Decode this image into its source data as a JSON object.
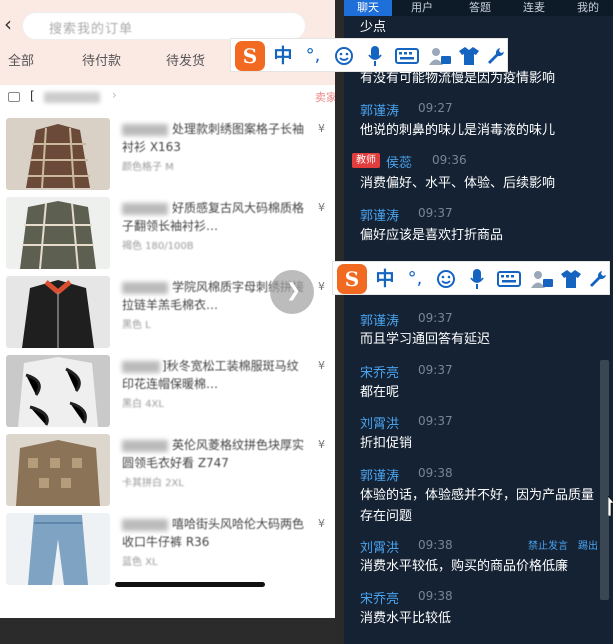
{
  "phone": {
    "search_placeholder": "搜索我的订单",
    "tabs": [
      "全部",
      "待付款",
      "待发货"
    ],
    "shop": {
      "name": "[",
      "status": "卖家"
    },
    "orders": [
      {
        "title": "处理款刺绣图案格子长袖衬衫 X163",
        "spec": "颜色格子 M",
        "price": "¥"
      },
      {
        "title": "好质感复古风大码棉质格子翻领长袖衬衫…",
        "spec": "褐色 180/100B",
        "price": "¥"
      },
      {
        "title": "学院风棉质字母刺绣拼接拉链羊羔毛棉衣…",
        "spec": "黑色 L",
        "price": "¥"
      },
      {
        "title": "]秋冬宽松工装棉服斑马纹印花连帽保暖棉…",
        "spec": "黑白 4XL",
        "price": "¥"
      },
      {
        "title": "英伦风菱格纹拼色块厚实圆领毛衣好看 Z747",
        "spec": "卡其拼白 2XL",
        "price": "¥"
      },
      {
        "title": "嘻哈街头风哈伦大码两色收口牛仔裤 R36",
        "spec": "蓝色 XL",
        "price": "¥"
      }
    ]
  },
  "chat": {
    "tabs": [
      "聊天",
      "用户",
      "答题",
      "连麦",
      "我的"
    ],
    "active_tab": "聊天",
    "messages": [
      {
        "name": "",
        "time": "",
        "text": "少点"
      },
      {
        "name": "",
        "time": "",
        "text": "有没有可能物流慢是因为疫情影响"
      },
      {
        "name": "郭谨涛",
        "time": "09:27",
        "text": "他说的刺鼻的味儿是消毒液的味儿"
      },
      {
        "name": "侯蕊",
        "time": "09:36",
        "text": "消费偏好、水平、体验、后续影响",
        "badge": "教师"
      },
      {
        "name": "郭谨涛",
        "time": "09:37",
        "text": "偏好应该是喜欢打折商品"
      },
      {
        "name": "郭谨涛",
        "time": "09:37",
        "text": "而且学习通回答有延迟"
      },
      {
        "name": "宋乔亮",
        "time": "09:37",
        "text": "都在呢"
      },
      {
        "name": "刘霄洪",
        "time": "09:37",
        "text": "折扣促销"
      },
      {
        "name": "郭谨涛",
        "time": "09:38",
        "text": "体验的话，体验感并不好，因为产品质量存在问题"
      },
      {
        "name": "刘霄洪",
        "time": "09:38",
        "text": "消费水平较低，购买的商品价格低廉",
        "actions": [
          "禁止发言",
          "踢出"
        ]
      },
      {
        "name": "宋乔亮",
        "time": "09:38",
        "text": "消费水平比较低"
      }
    ]
  },
  "ime": {
    "logo": "S",
    "mode": "中",
    "punct": "°,",
    "icons": [
      "emoji-icon",
      "microphone-icon",
      "keyboard-icon",
      "user-card-icon",
      "skin-shirt-icon",
      "wrench-icon"
    ]
  },
  "colors": {
    "chat_bg": "#142233",
    "tab_active": "#1e6fd9",
    "name_blue": "#4aa3ef",
    "teacher_badge": "#e23d3d",
    "ime_logo": "#f26a21",
    "ime_icons": "#1565c0"
  }
}
